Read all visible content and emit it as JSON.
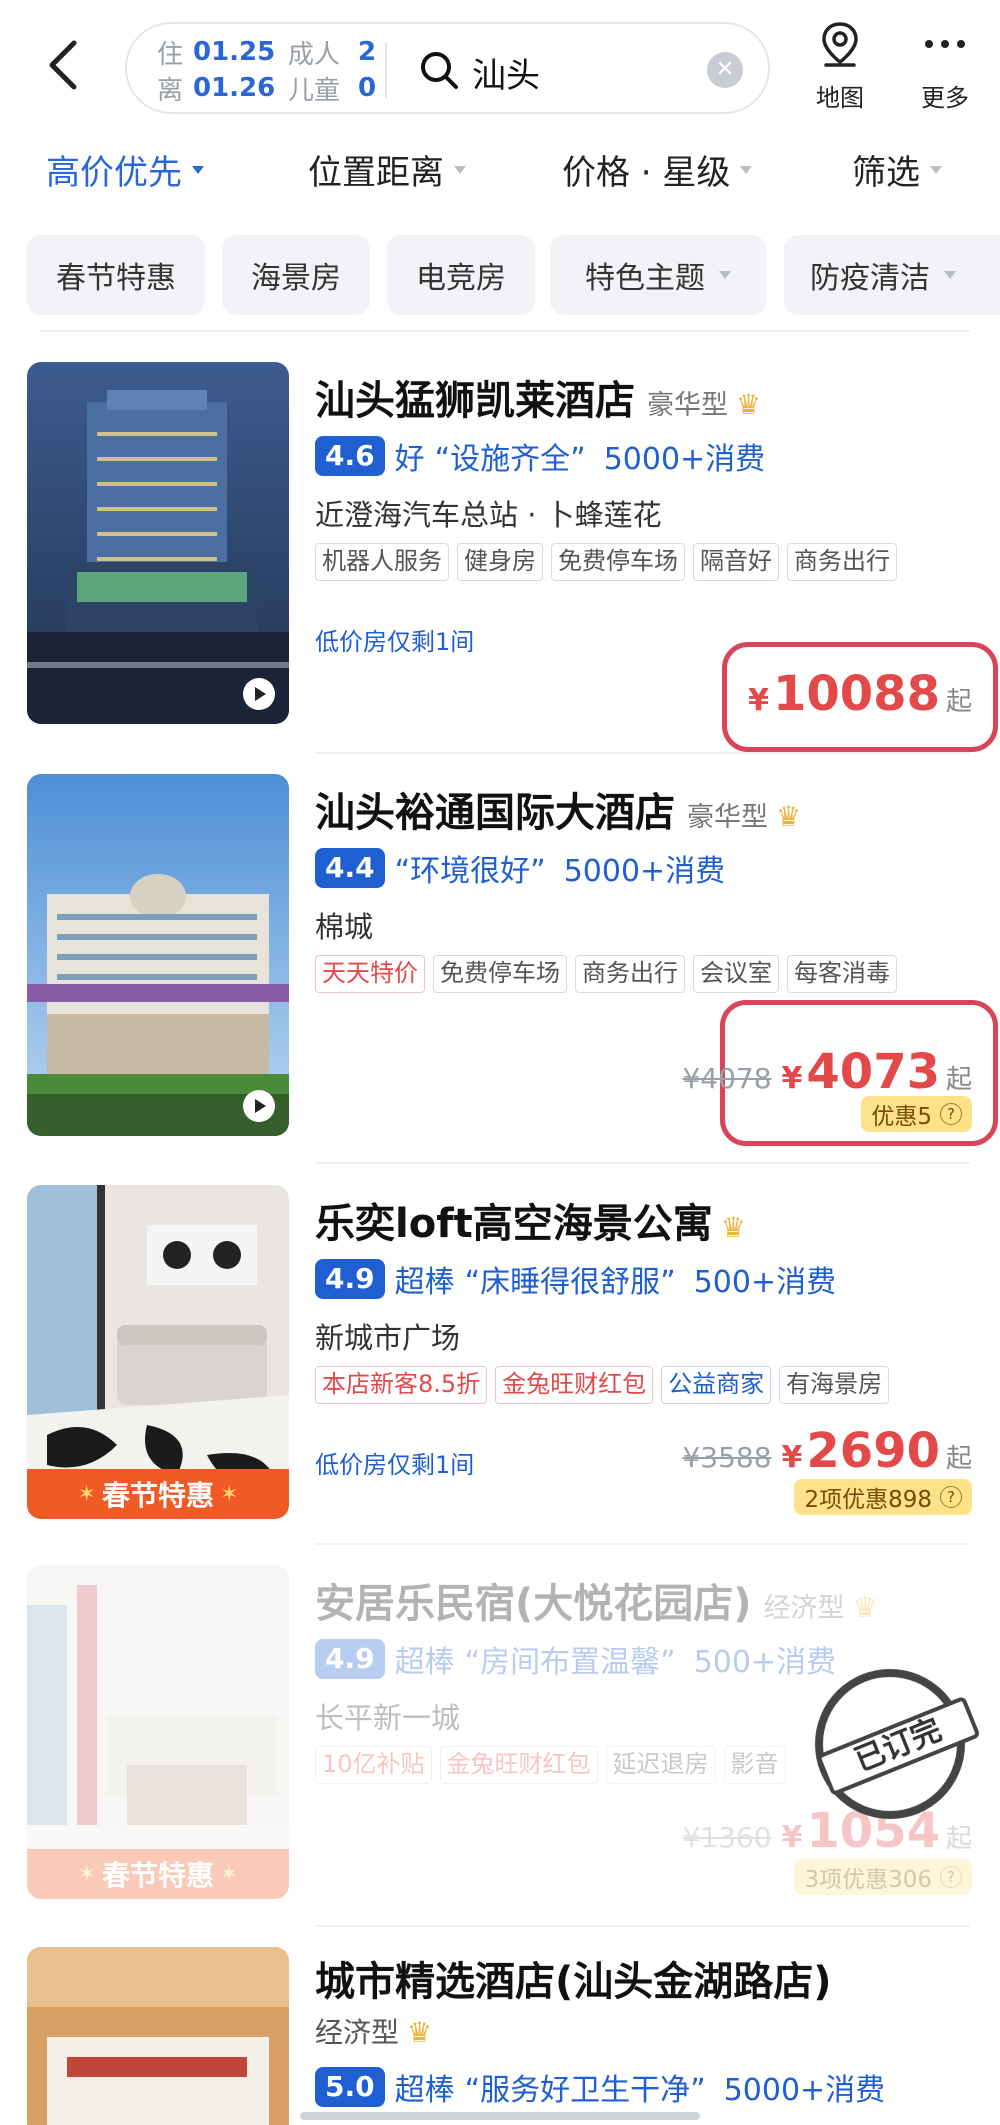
{
  "header": {
    "checkin_label": "住",
    "checkin_date": "01.25",
    "checkout_label": "离",
    "checkout_date": "01.26",
    "adults_label": "成人",
    "adults_count": "2",
    "children_label": "儿童",
    "children_count": "0",
    "search_query": "汕头",
    "map_label": "地图",
    "more_label": "更多"
  },
  "sort_tabs": [
    {
      "label": "高价优先",
      "active": true
    },
    {
      "label": "位置距离"
    },
    {
      "label": "价格 · 星级"
    },
    {
      "label": "筛选"
    }
  ],
  "chips": [
    "春节特惠",
    "海景房",
    "电竞房",
    "特色主题",
    "防疫清洁"
  ],
  "hotels": [
    {
      "name": "汕头猛狮凯莱酒店",
      "grade": "豪华型",
      "score": "4.6",
      "score_word": "好",
      "quote": "“设施齐全”",
      "count": "5000+消费",
      "location": "近澄海汽车总站 · 卜蜂莲花",
      "tags": [
        "机器人服务",
        "健身房",
        "免费停车场",
        "隔音好",
        "商务出行"
      ],
      "note": "低价房仅剩1间",
      "yen": "¥",
      "price": "10088",
      "qi": "起"
    },
    {
      "name": "汕头裕通国际大酒店",
      "grade": "豪华型",
      "score": "4.4",
      "score_word": "",
      "quote": "“环境很好”",
      "count": "5000+消费",
      "location": "棉城",
      "tags": [
        "天天特价",
        "免费停车场",
        "商务出行",
        "会议室",
        "每客消毒"
      ],
      "old_price": "¥4078",
      "yen": "¥",
      "price": "4073",
      "qi": "起",
      "discount": "优惠5"
    },
    {
      "name": "乐奕loft高空海景公寓",
      "grade": "",
      "score": "4.9",
      "score_word": "超棒",
      "quote": "“床睡得很舒服”",
      "count": "500+消费",
      "location": "新城市广场",
      "tags": [
        "本店新客8.5折",
        "金兔旺财红包",
        "公益商家",
        "有海景房"
      ],
      "note": "低价房仅剩1间",
      "old_price": "¥3588",
      "yen": "¥",
      "price": "2690",
      "qi": "起",
      "discount": "2项优惠898",
      "ribbon": "春节特惠"
    },
    {
      "name": "安居乐民宿(大悦花园店)",
      "grade": "经济型",
      "score": "4.9",
      "score_word": "超棒",
      "quote": "“房间布置温馨”",
      "count": "500+消费",
      "location": "长平新一城",
      "tags": [
        "10亿补贴",
        "金兔旺财红包",
        "延迟退房",
        "影音"
      ],
      "old_price": "¥1360",
      "yen": "¥",
      "price": "1054",
      "qi": "起",
      "discount": "3项优惠306",
      "ribbon": "春节特惠",
      "stamp": "已订完"
    },
    {
      "name": "城市精选酒店(汕头金湖路店)",
      "grade": "经济型",
      "score": "5.0",
      "score_word": "超棒",
      "quote": "“服务好卫生干净”",
      "count": "5000+消费"
    }
  ],
  "colors": {
    "brand_blue": "#1f5fd1",
    "price_red": "#e34949",
    "highlight": "#d8445a"
  }
}
